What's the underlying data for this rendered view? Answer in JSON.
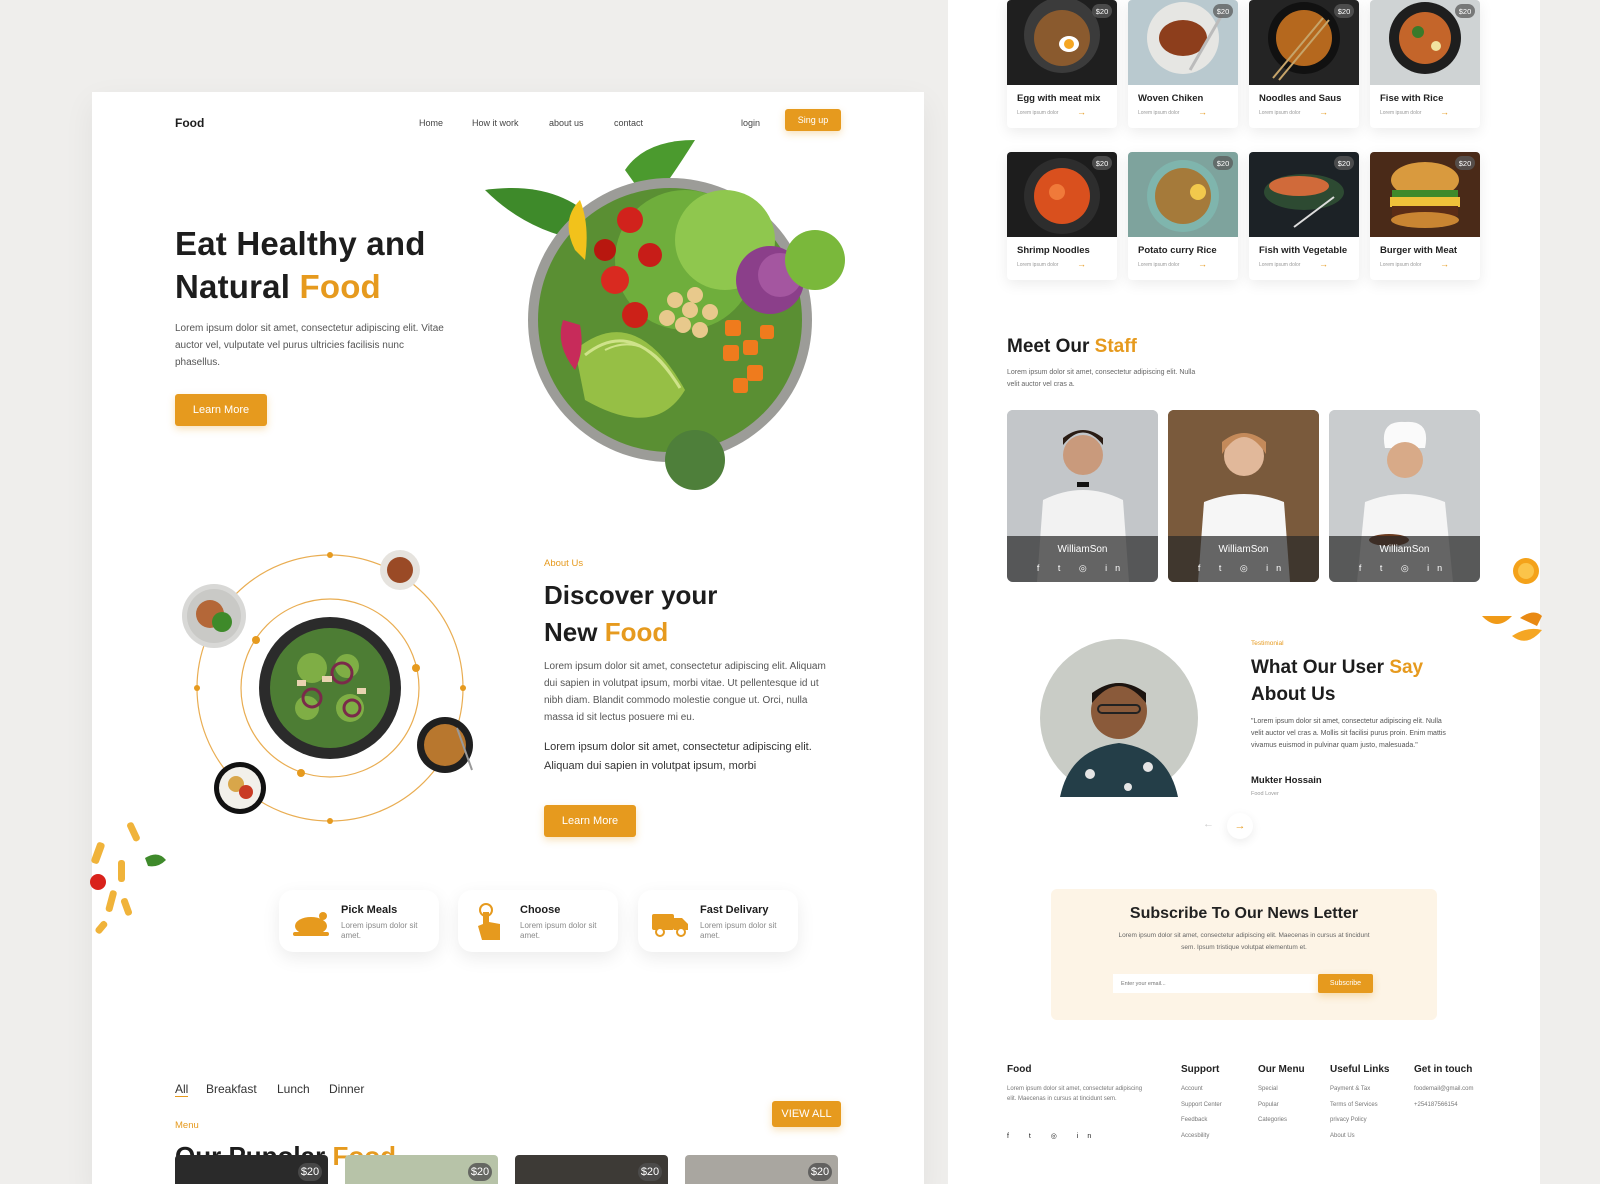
{
  "brand": "Food",
  "nav": {
    "items": [
      "Home",
      "How it work",
      "about us",
      "contact"
    ],
    "login": "login",
    "signup": "Sing up"
  },
  "hero": {
    "title_line1": "Eat Healthy and",
    "title_line2_plain": "Natural",
    "title_line2_accent": "Food",
    "description": "Lorem ipsum dolor sit amet, consectetur adipiscing elit. Vitae auctor vel, vulputate vel purus ultricies facilisis nunc phasellus.",
    "cta": "Learn More"
  },
  "about": {
    "eyebrow": "About Us",
    "title_line1": "Discover your",
    "title_line2_plain": "New",
    "title_line2_accent": "Food",
    "para1": "Lorem ipsum dolor sit amet, consectetur adipiscing elit. Aliquam dui sapien in volutpat ipsum, morbi vitae. Ut pellentesque id ut nibh diam. Blandit commodo molestie congue ut. Orci, nulla massa id sit lectus posuere mi eu.",
    "para2": "Lorem ipsum dolor sit amet, consectetur adipiscing elit. Aliquam dui sapien in volutpat ipsum, morbi",
    "cta": "Learn More"
  },
  "features": [
    {
      "title": "Pick Meals",
      "desc": "Lorem ipsum dolor sit amet."
    },
    {
      "title": "Choose",
      "desc": "Lorem ipsum dolor sit amet."
    },
    {
      "title": "Fast Delivary",
      "desc": "Lorem ipsum dolor sit amet."
    }
  ],
  "menu": {
    "eyebrow": "Menu",
    "title_plain": "Our Pupolar",
    "title_accent": "Food",
    "tabs": [
      "All",
      "Breakfast",
      "Lunch",
      "Dinner"
    ],
    "view_all": "VIEW ALL",
    "bottom_prices": [
      "$20",
      "$20",
      "$20",
      "$20"
    ]
  },
  "products": [
    {
      "name": "Egg with meat mix",
      "price": "$20",
      "desc": "Lorem ipsum dolor"
    },
    {
      "name": "Woven Chiken",
      "price": "$20",
      "desc": "Lorem ipsum dolor"
    },
    {
      "name": "Noodles and Saus",
      "price": "$20",
      "desc": "Lorem ipsum dolor"
    },
    {
      "name": "Fise with Rice",
      "price": "$20",
      "desc": "Lorem ipsum dolor"
    },
    {
      "name": "Shrimp Noodles",
      "price": "$20",
      "desc": "Lorem ipsum dolor"
    },
    {
      "name": "Potato curry Rice",
      "price": "$20",
      "desc": "Lorem ipsum dolor"
    },
    {
      "name": "Fish with Vegetable",
      "price": "$20",
      "desc": "Lorem ipsum dolor"
    },
    {
      "name": "Burger with Meat",
      "price": "$20",
      "desc": "Lorem ipsum dolor"
    }
  ],
  "staff": {
    "title_plain": "Meet Our",
    "title_accent": "Staff",
    "desc": "Lorem ipsum dolor sit amet, consectetur adipiscing elit. Nulla velit auctor vel cras a.",
    "members": [
      {
        "name": "WilliamSon"
      },
      {
        "name": "WilliamSon"
      },
      {
        "name": "WilliamSon"
      }
    ]
  },
  "testimonial": {
    "eyebrow": "Testimonial",
    "title_plain": "What Our User",
    "title_accent": "Say",
    "title_line2": "About Us",
    "quote": "\"Lorem ipsum dolor sit amet, consectetur adipiscing elit. Nulla velit auctor vel cras a. Mollis sit facilisi purus proin. Enim mattis vivamus euismod in pulvinar quam justo, malesuada.\"",
    "author": "Mukter Hossain",
    "role": "Food Lover"
  },
  "newsletter": {
    "title": "Subscribe To Our News Letter",
    "desc": "Lorem ipsum dolor sit amet, consectetur adipiscing elit. Maecenas in cursus at tincidunt sem. Ipsum tristique volutpat elementum et.",
    "placeholder": "Enter your email...",
    "button": "Subscribe"
  },
  "footer": {
    "brand": "Food",
    "about": "Lorem ipsum dolor sit amet, consectetur adipiscing elit. Maecenas in cursus at tincidunt sem.",
    "support": {
      "title": "Support",
      "links": [
        "Account",
        "Support Center",
        "Feedback",
        "Accesbility"
      ]
    },
    "our_menu": {
      "title": "Our Menu",
      "links": [
        "Special",
        "Popular",
        "Categories"
      ]
    },
    "useful": {
      "title": "Useful Links",
      "links": [
        "Payment & Tax",
        "Terms of Services",
        "privacy Policy",
        "About Us"
      ]
    },
    "contact": {
      "title": "Get in touch",
      "email": "foodemail@gmail.com",
      "phone": "+254187566154"
    }
  },
  "colors": {
    "accent": "#e69a1e",
    "bg": "#efeeec"
  }
}
